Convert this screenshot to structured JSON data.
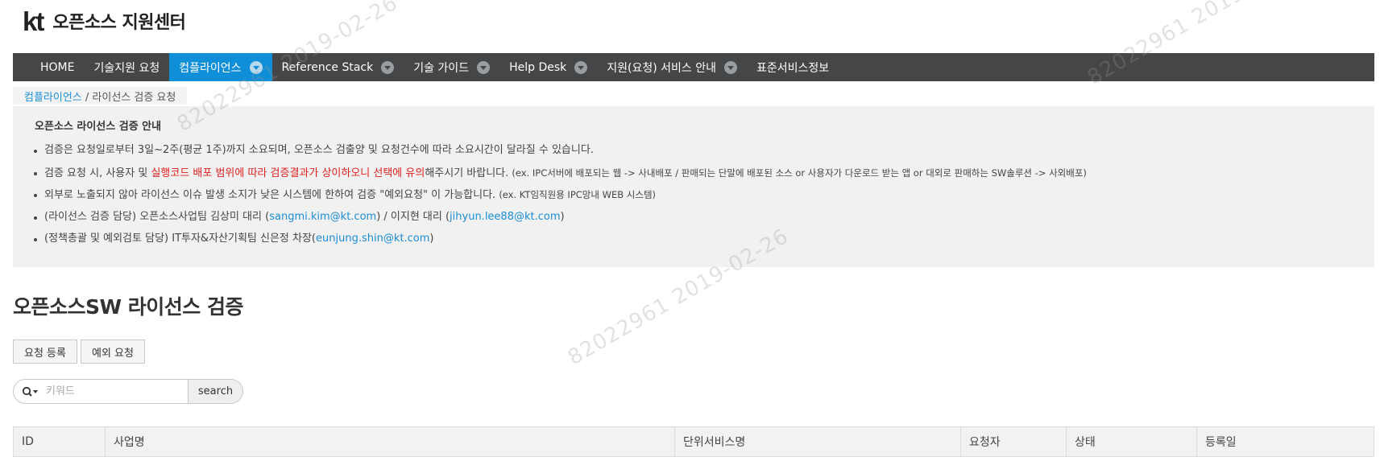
{
  "header": {
    "logo": "kt",
    "title": "오픈소스 지원센터"
  },
  "nav": {
    "items": [
      {
        "label": "HOME",
        "dropdown": false,
        "active": false
      },
      {
        "label": "기술지원 요청",
        "dropdown": false,
        "active": false
      },
      {
        "label": "컴플라이언스",
        "dropdown": true,
        "active": true
      },
      {
        "label": "Reference Stack",
        "dropdown": true,
        "active": false
      },
      {
        "label": "기술 가이드",
        "dropdown": true,
        "active": false
      },
      {
        "label": "Help Desk",
        "dropdown": true,
        "active": false
      },
      {
        "label": "지원(요청) 서비스 안내",
        "dropdown": true,
        "active": false
      },
      {
        "label": "표준서비스정보",
        "dropdown": false,
        "active": false
      }
    ]
  },
  "breadcrumb": {
    "parent": "컴플라이언스",
    "separator": " / ",
    "current": "라이선스 검증 요청"
  },
  "info": {
    "title": "오픈소스 라이선스 검증 안내",
    "items": [
      {
        "text": "검증은 요청일로부터 3일~2주(평균 1주)까지 소요되며, 오픈소스 검출양 및 요청건수에 따라 소요시간이 달라질 수 있습니다."
      },
      {
        "text_a": "검증 요청 시, 사용자 및 ",
        "highlight": "실행코드 배포 범위에 따라 검증결과가 상이하오니 선택에 유의",
        "text_b": "해주시기 바랍니다.",
        "note": "(ex. IPC서버에 배포되는 웹 -> 사내배포 / 판매되는 단말에 배포된 소스 or 사용자가 다운로드 받는 앱 or 대외로 판매하는 SW솔루션 -> 사외배포)"
      },
      {
        "text": "외부로 노출되지 않아 라이선스 이슈 발생 소지가 낮은 시스템에 한하여 검증 \"예외요청\" 이 가능합니다.",
        "note": "(ex. KT임직원용 IPC망내 WEB 시스템)"
      },
      {
        "text_a": "(라이선스 검증 담당) 오픈소스사업팀 김상미 대리 (",
        "email1": "sangmi.kim@kt.com",
        "text_b": ") / 이지현 대리 (",
        "email2": "jihyun.lee88@kt.com",
        "text_c": ")"
      },
      {
        "text_a": "(정책총괄 및 예외검토 담당) IT투자&자산기획팀 신은정 차장(",
        "email": "eunjung.shin@kt.com",
        "text_b": ")"
      }
    ]
  },
  "page_heading": "오픈소스SW 라이선스 검증",
  "actions": {
    "register": "요청 등록",
    "exception": "예외 요청"
  },
  "search": {
    "placeholder": "키워드",
    "value": "",
    "button": "search"
  },
  "table": {
    "columns": [
      "ID",
      "사업명",
      "단위서비스명",
      "요청자",
      "상태",
      "등록일"
    ]
  },
  "watermark": {
    "text": "82022961  2019-02-26"
  },
  "colors": {
    "nav_bg": "#444648",
    "nav_active": "#0f8fd7",
    "link": "#1a8ed6",
    "highlight": "#e02020"
  }
}
